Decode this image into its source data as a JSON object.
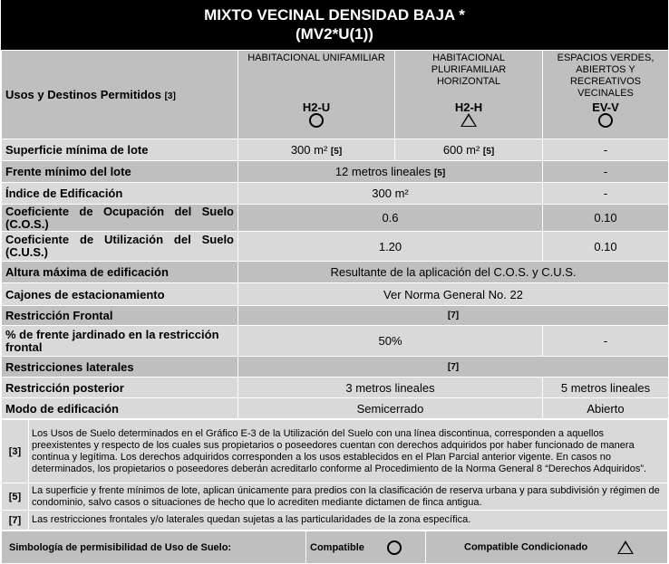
{
  "title": {
    "line1": "MIXTO VECINAL DENSIDAD BAJA *",
    "line2": "(MV2*U(1))"
  },
  "header": {
    "label": "Usos y Destinos Permitidos",
    "label_note": "[3]",
    "columns": [
      {
        "name": "HABITACIONAL UNIFAMILIAR",
        "code": "H2-U",
        "symbol": "circle"
      },
      {
        "name": "HABITACIONAL PLURIFAMILIAR HORIZONTAL",
        "code": "H2-H",
        "symbol": "triangle"
      },
      {
        "name": "ESPACIOS VERDES, ABIERTOS Y RECREATIVOS VECINALES",
        "code": "EV-V",
        "symbol": "circle"
      }
    ]
  },
  "rows": {
    "superficie": {
      "label": "Superficie mínima de lote",
      "v1": "300 m²",
      "n1": "[5]",
      "v2": "600 m²",
      "n2": "[5]",
      "v3": "-"
    },
    "frente": {
      "label": "Frente mínimo del lote",
      "v12": "12 metros lineales",
      "n12": "[5]",
      "v3": "-"
    },
    "indice": {
      "label": "Índice de Edificación",
      "v12": "300 m²",
      "v3": "-"
    },
    "cos": {
      "label": "Coeficiente de Ocupación del Suelo (C.O.S.)",
      "v12": "0.6",
      "v3": "0.10"
    },
    "cus": {
      "label": "Coeficiente de Utilización del Suelo (C.U.S.)",
      "v12": "1.20",
      "v3": "0.10"
    },
    "altura": {
      "label": "Altura máxima de edificación",
      "v": "Resultante de la aplicación del C.O.S. y C.U.S."
    },
    "cajones": {
      "label": "Cajones de estacionamiento",
      "v": "Ver Norma General No. 22"
    },
    "frontal": {
      "label": "Restricción Frontal",
      "v": "[7]"
    },
    "jardinado": {
      "label": "% de frente jardinado en la restricción frontal",
      "v12": "50%",
      "v3": "-"
    },
    "laterales": {
      "label": "Restricciones laterales",
      "v": "[7]"
    },
    "posterior": {
      "label": "Restricción posterior",
      "v12": "3 metros lineales",
      "v3": "5 metros lineales"
    },
    "modo": {
      "label": "Modo de edificación",
      "v12": "Semicerrado",
      "v3": "Abierto"
    }
  },
  "footnotes": [
    {
      "key": "[3]",
      "text": "Los Usos de Suelo determinados en el Gráfico E-3 de la Utilización del Suelo con una línea discontinua, corresponden a aquellos preexistentes y respecto de los cuales sus propietarios o poseedores cuentan con derechos adquiridos por haber funcionado de manera continua y legítima. Los derechos adquiridos corresponden a los usos establecidos en el Plan Parcial anterior vigente. En casos no determinados, los propietarios o poseedores deberán acreditarlo conforme al Procedimiento de la Norma General 8 “Derechos Adquiridos”."
    },
    {
      "key": "[5]",
      "text": "La superficie y frente mínimos de lote, aplican únicamente para predios con la clasificación de reserva urbana y para subdivisión y régimen de condominio, salvo casos o situaciones de hecho que lo acrediten mediante dictamen de finca antigua."
    },
    {
      "key": "[7]",
      "text": "Las restricciones frontales y/o laterales quedan sujetas a las particularidades de la zona específica."
    }
  ],
  "legend": {
    "label": "Simbología de permisibilidad de Uso de Suelo:",
    "compatible": "Compatible",
    "compatible_symbol": "circle",
    "conditioned": "Compatible Condicionado",
    "conditioned_symbol": "triangle"
  },
  "colors": {
    "title_bg": "#000000",
    "row_light": "#d9d9d9",
    "row_dark": "#bfbfbf"
  }
}
